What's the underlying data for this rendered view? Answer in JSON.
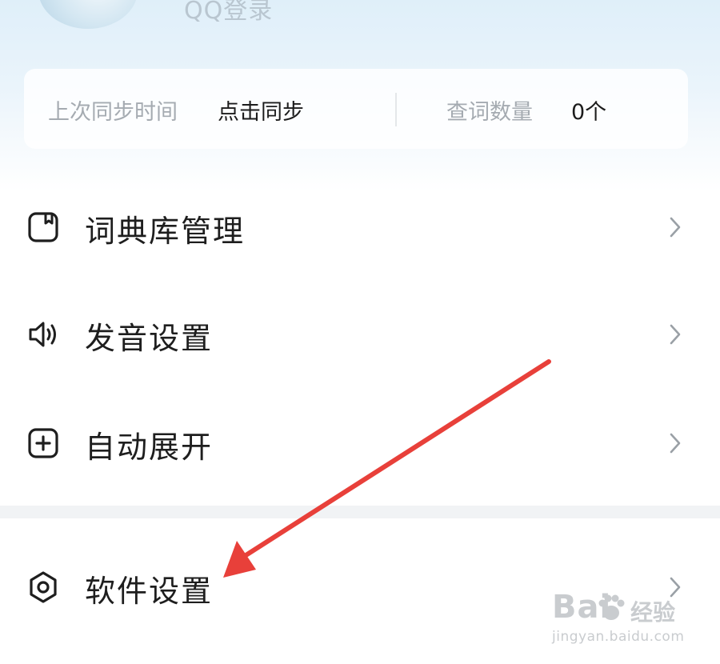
{
  "header": {
    "login_label": "QQ登录"
  },
  "sync_card": {
    "last_sync_label": "上次同步时间",
    "sync_action": "点击同步",
    "lookup_label": "查词数量",
    "lookup_count": "0个"
  },
  "menu": {
    "items": [
      {
        "label": "词典库管理",
        "icon": "book-icon"
      },
      {
        "label": "发音设置",
        "icon": "speaker-icon"
      },
      {
        "label": "自动展开",
        "icon": "plus-square-icon"
      },
      {
        "label": "软件设置",
        "icon": "hexagon-settings-icon"
      }
    ]
  },
  "annotation": {
    "arrow_color": "#e8403a"
  },
  "watermark": {
    "brand": "Bai",
    "brand_suffix": "经验",
    "url": "jingyan.baidu.com"
  },
  "colors": {
    "background": "#ffffff",
    "header_gradient": "#dfeff9",
    "text_primary": "#1e1e1e",
    "text_secondary": "#a5abb1"
  }
}
